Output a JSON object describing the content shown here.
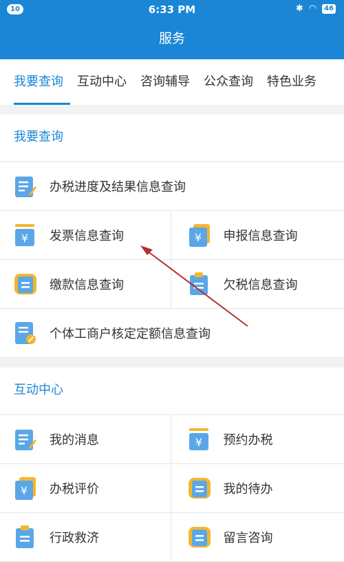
{
  "status_bar": {
    "notification_count": "10",
    "time": "6:33 PM",
    "battery": "46"
  },
  "header": {
    "title": "服务"
  },
  "tabs": [
    {
      "label": "我要查询",
      "active": true
    },
    {
      "label": "互动中心"
    },
    {
      "label": "咨询辅导"
    },
    {
      "label": "公众查询"
    },
    {
      "label": "特色业务"
    }
  ],
  "sections": {
    "query": {
      "title": "我要查询",
      "items": {
        "progress": "办税进度及结果信息查询",
        "invoice": "发票信息查询",
        "declare": "申报信息查询",
        "payment": "缴款信息查询",
        "arrears": "欠税信息查询",
        "quota": "个体工商户核定定额信息查询"
      }
    },
    "interact": {
      "title": "互动中心",
      "items": {
        "messages": "我的消息",
        "appointment": "预约办税",
        "evaluation": "办税评价",
        "todo": "我的待办",
        "relief": "行政救济",
        "consult": "留言咨询"
      }
    }
  },
  "colors": {
    "accent": "#1b86d6",
    "icon_blue": "#5aa7e8",
    "icon_yellow": "#f5b52e",
    "arrow": "#b03030"
  }
}
